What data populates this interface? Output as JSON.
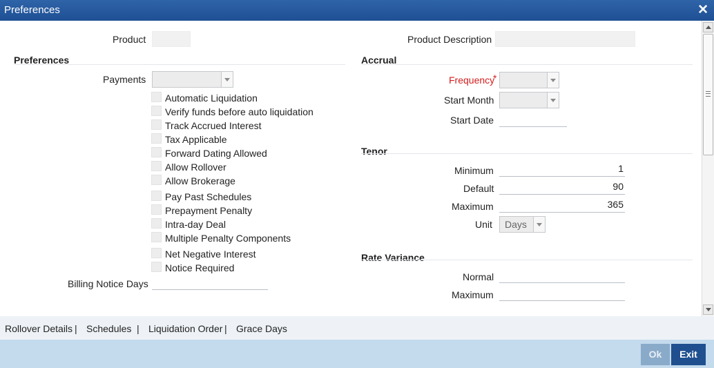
{
  "window": {
    "title": "Preferences"
  },
  "header": {
    "product_label": "Product",
    "product_value": "",
    "product_description_label": "Product Description",
    "product_description_value": ""
  },
  "preferences": {
    "section_title": "Preferences",
    "payments_label": "Payments",
    "payments_value": "",
    "checkboxes": [
      "Automatic Liquidation",
      "Verify funds before auto liquidation",
      "Track Accrued Interest",
      "Tax Applicable",
      "Forward Dating Allowed",
      "Allow Rollover",
      "Allow Brokerage",
      "Pay Past Schedules",
      "Prepayment Penalty",
      "Intra-day Deal",
      "Multiple Penalty Components",
      "Net Negative Interest",
      "Notice Required"
    ],
    "billing_notice_days_label": "Billing Notice Days",
    "billing_notice_days_value": ""
  },
  "accrual": {
    "section_title": "Accrual",
    "frequency_label": "Frequency",
    "required_marker": "*",
    "frequency_value": "",
    "start_month_label": "Start Month",
    "start_month_value": "",
    "start_date_label": "Start Date",
    "start_date_value": ""
  },
  "tenor": {
    "section_title": "Tenor",
    "minimum_label": "Minimum",
    "minimum_value": "1",
    "default_label": "Default",
    "default_value": "90",
    "maximum_label": "Maximum",
    "maximum_value": "365",
    "unit_label": "Unit",
    "unit_value": "Days"
  },
  "rate_variance": {
    "section_title": "Rate Variance",
    "normal_label": "Normal",
    "normal_value": "",
    "maximum_label": "Maximum",
    "maximum_value": ""
  },
  "tabs": [
    {
      "label": "Rollover Details"
    },
    {
      "label": "Schedules"
    },
    {
      "label": "Liquidation Order"
    },
    {
      "label": "Grace Days"
    }
  ],
  "tab_separator": "|",
  "footer": {
    "ok_label": "Ok",
    "exit_label": "Exit"
  },
  "colors": {
    "titlebar": "#1e4f94",
    "footer": "#c4daed",
    "required": "#d21d1d",
    "exit_button": "#1f4f8f"
  }
}
